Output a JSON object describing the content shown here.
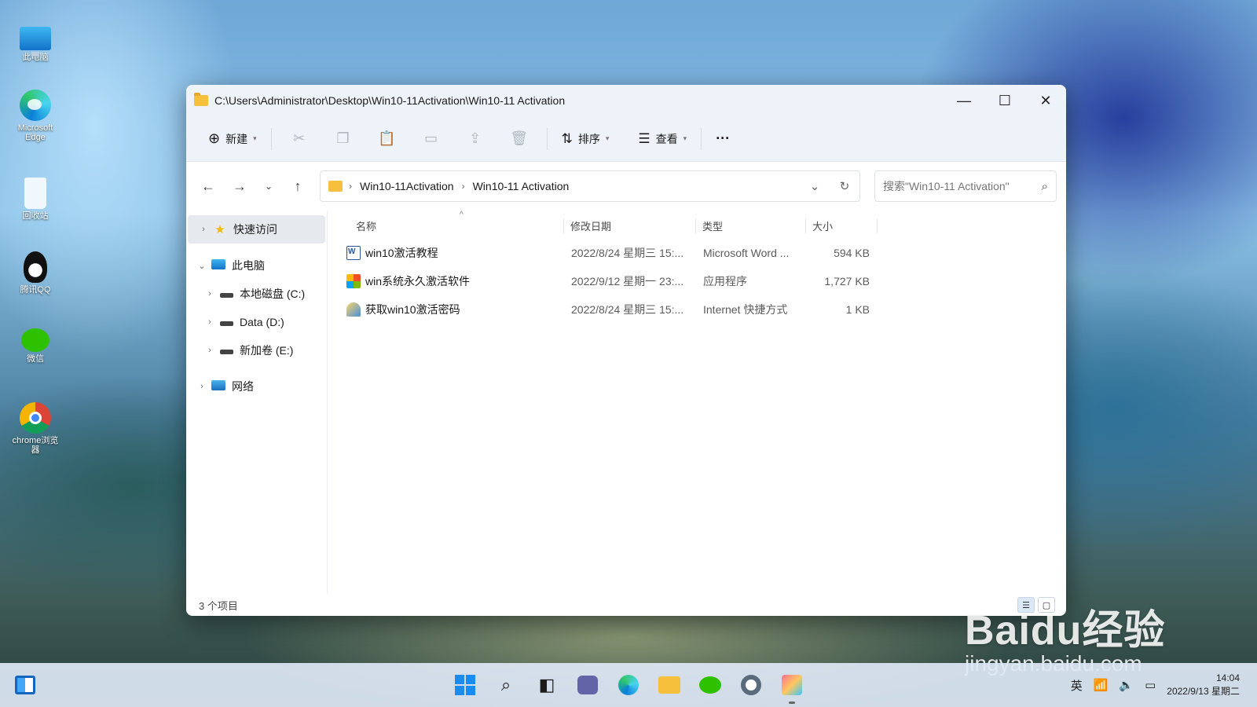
{
  "desktop": {
    "icons": [
      {
        "label": "此电脑"
      },
      {
        "label": "Microsoft Edge"
      },
      {
        "label": "回收站"
      },
      {
        "label": "腾讯QQ"
      },
      {
        "label": "微信"
      },
      {
        "label": "chrome浏览器"
      }
    ]
  },
  "window": {
    "title": "C:\\Users\\Administrator\\Desktop\\Win10-11Activation\\Win10-11 Activation",
    "controls": {
      "minimize": "—",
      "maximize": "☐",
      "close": "✕"
    }
  },
  "toolbar": {
    "new_label": "新建",
    "sort_label": "排序",
    "view_label": "查看",
    "more_label": "···"
  },
  "nav": {
    "back": "←",
    "forward": "→",
    "recent": "⌄",
    "up": "↑",
    "breadcrumb": [
      "Win10-11Activation",
      "Win10-11 Activation"
    ],
    "search_placeholder": "搜索\"Win10-11 Activation\""
  },
  "sidebar": {
    "quick_access": "快速访问",
    "this_pc": "此电脑",
    "drives": [
      "本地磁盘 (C:)",
      "Data (D:)",
      "新加卷 (E:)"
    ],
    "network": "网络"
  },
  "columns": {
    "name": "名称",
    "date": "修改日期",
    "type": "类型",
    "size": "大小"
  },
  "files": [
    {
      "name": "win10激活教程",
      "date": "2022/8/24 星期三 15:...",
      "type": "Microsoft Word ...",
      "size": "594 KB",
      "icon": "word-doc-icon"
    },
    {
      "name": "win系统永久激活软件",
      "date": "2022/9/12 星期一 23:...",
      "type": "应用程序",
      "size": "1,727 KB",
      "icon": "app-icon"
    },
    {
      "name": "获取win10激活密码",
      "date": "2022/8/24 星期三 15:...",
      "type": "Internet 快捷方式",
      "size": "1 KB",
      "icon": "internet-shortcut-icon"
    }
  ],
  "status": {
    "count": "3 个项目"
  },
  "watermark": {
    "line1": "Baidu经验",
    "line2": "jingyan.baidu.com"
  },
  "taskbar": {
    "ime": "英",
    "time": "14:04",
    "date": "2022/9/13 星期二"
  },
  "colors": {
    "accent": "#1a8cf0",
    "folder": "#f6c03c",
    "titlebar": "#eef3f9"
  }
}
